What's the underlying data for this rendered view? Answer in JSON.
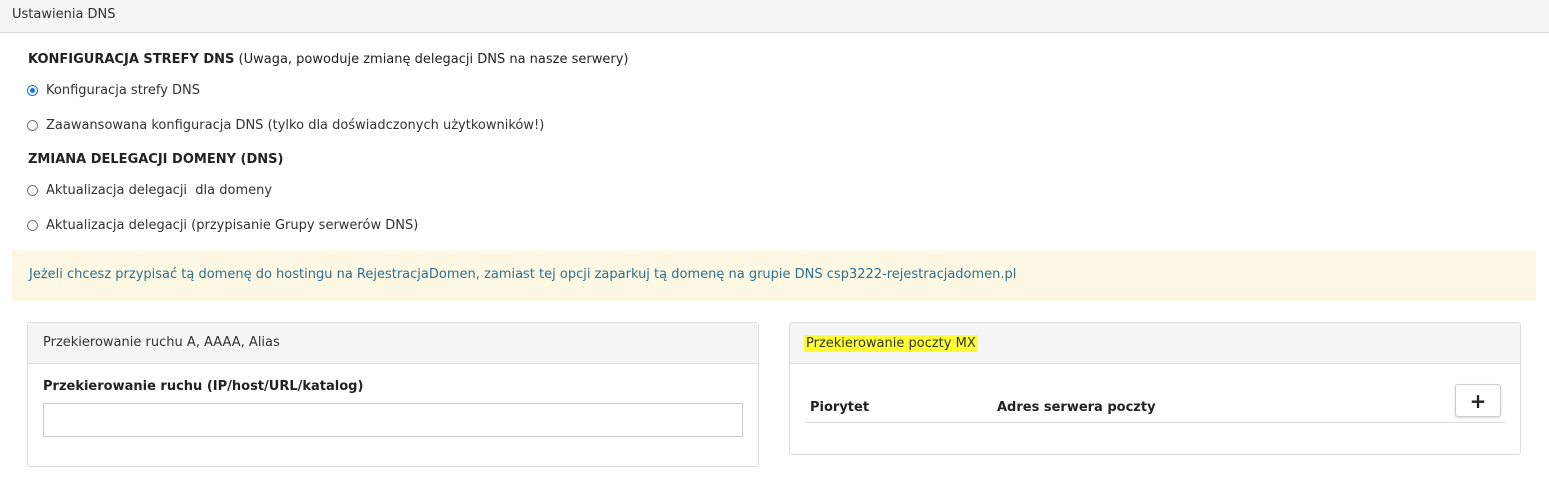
{
  "panel": {
    "title": "Ustawienia DNS"
  },
  "dns_zone": {
    "heading": "KONFIGURACJA STREFY DNS",
    "note": " (Uwaga, powoduje zmianę delegacji DNS na nasze serwery)",
    "options": [
      {
        "label": "Konfiguracja strefy DNS",
        "checked": true
      },
      {
        "label": "Zaawansowana konfiguracja DNS (tylko dla doświadczonych użytkowników!)",
        "checked": false
      }
    ]
  },
  "delegation": {
    "heading": "ZMIANA DELEGACJI DOMENY (DNS)",
    "options": [
      {
        "label": "Aktualizacja delegacji  dla domeny",
        "checked": false
      },
      {
        "label": "Aktualizacja delegacji (przypisanie Grupy serwerów DNS)",
        "checked": false
      }
    ]
  },
  "alert": {
    "text": "Jeżeli chcesz przypisać tą domenę do hostingu na RejestracjaDomen, zamiast tej opcji zaparkuj tą domenę na grupie DNS csp3222-rejestracjadomen.pl"
  },
  "traffic_box": {
    "title": "Przekierowanie ruchu A, AAAA, Alias",
    "field_label": "Przekierowanie ruchu (IP/host/URL/katalog)",
    "field_value": ""
  },
  "mx_box": {
    "title": "Przekierowanie poczty MX",
    "highlight_color": "#ffff33",
    "columns": [
      "Piorytet",
      "Adres serwera poczty"
    ],
    "add_label": "+"
  },
  "colors": {
    "alert_bg": "#fcf8e3",
    "alert_text": "#31708f",
    "radio_accent": "#1a73e8"
  }
}
